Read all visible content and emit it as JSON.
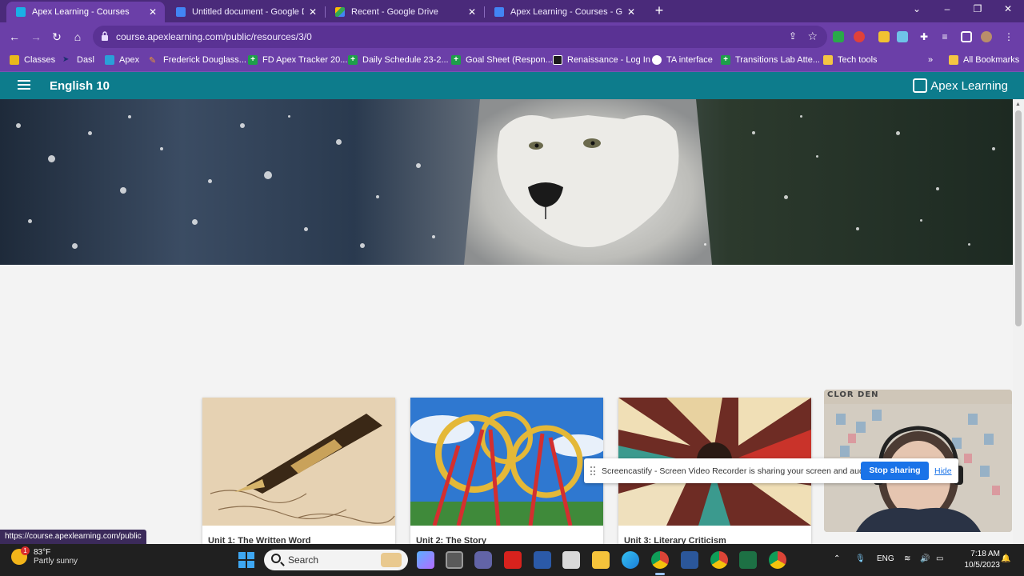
{
  "browser": {
    "tabs": [
      {
        "title": "Apex Learning - Courses",
        "active": true,
        "favicon_color": "#1ab0e6"
      },
      {
        "title": "Untitled document - Google Do",
        "active": false,
        "favicon_color": "#4285f4"
      },
      {
        "title": "Recent - Google Drive",
        "active": false,
        "favicon_color": "#34a853"
      },
      {
        "title": "Apex Learning - Courses - Goog",
        "active": false,
        "favicon_color": "#4285f4"
      }
    ],
    "url": "course.apexlearning.com/public/resources/3/0",
    "bookmarks": [
      {
        "label": "Classes",
        "icon": "classroom-icon"
      },
      {
        "label": "Dasl",
        "icon": "bird-icon"
      },
      {
        "label": "Apex",
        "icon": "apex-icon"
      },
      {
        "label": "Frederick Douglass...",
        "icon": "quill-icon"
      },
      {
        "label": "FD Apex Tracker 20...",
        "icon": "sheets-icon"
      },
      {
        "label": "Daily Schedule 23-2...",
        "icon": "sheets-icon"
      },
      {
        "label": "Goal Sheet (Respon...",
        "icon": "sheets-icon"
      },
      {
        "label": "Renaissance - Log In",
        "icon": "renaissance-icon"
      },
      {
        "label": "TA interface",
        "icon": "globe-icon"
      },
      {
        "label": "Transitions Lab Atte...",
        "icon": "sheets-icon"
      },
      {
        "label": "Tech tools",
        "icon": "folder-icon"
      }
    ],
    "all_bookmarks": "All Bookmarks"
  },
  "app": {
    "course_title": "English 10",
    "brand": "Apex Learning"
  },
  "units": [
    {
      "label": "Unit 1: The Written Word",
      "image": "fountain-pen-image"
    },
    {
      "label": "Unit 2: The Story",
      "image": "roller-coaster-image"
    },
    {
      "label": "Unit 3: Literary Criticism",
      "image": "books-image"
    }
  ],
  "screencastify": {
    "message": "Screencastify - Screen Video Recorder is sharing your screen and audio.",
    "stop_label": "Stop sharing",
    "hide_label": "Hide"
  },
  "status_url": "https://course.apexlearning.com/public",
  "taskbar": {
    "weather_temp": "83°F",
    "weather_desc": "Partly sunny",
    "weather_badge": "1",
    "search_label": "Search",
    "lang": "ENG",
    "time": "7:18 AM",
    "date": "10/5/2023"
  },
  "webcam_sign": "CLOR DEN"
}
